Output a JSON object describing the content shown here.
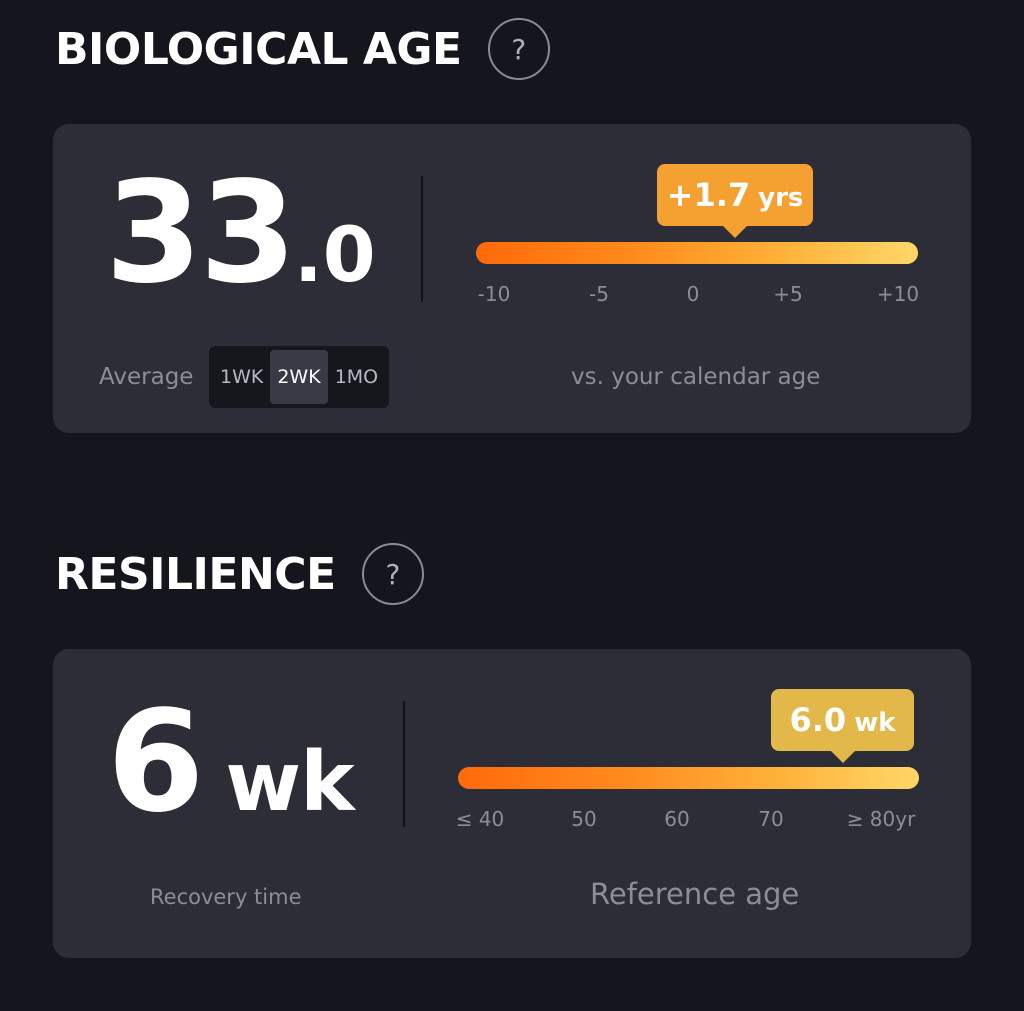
{
  "biological_age": {
    "title": "BIOLOGICAL AGE",
    "help": "?",
    "value_int": "33",
    "value_dec": ".0",
    "average_label": "Average",
    "ranges": [
      "1WK",
      "2WK",
      "1MO"
    ],
    "selected_range": "2WK",
    "callout_value": "+1.7",
    "callout_unit": "yrs",
    "scale_ticks": [
      "-10",
      "-5",
      "0",
      "+5",
      "+10"
    ],
    "scale_position": 1.7,
    "scale_min": -10,
    "scale_max": 10,
    "caption": "vs. your calendar age",
    "callout_color": "#f5a132"
  },
  "resilience": {
    "title": "RESILIENCE",
    "help": "?",
    "value_num": "6",
    "value_unit": "wk",
    "sub_label": "Recovery time",
    "callout_value": "6.0",
    "callout_unit": "wk",
    "scale_ticks": [
      "≤ 40",
      "50",
      "60",
      "70",
      "≥ 80yr"
    ],
    "caption": "Reference age",
    "callout_color": "#e3b84a"
  }
}
